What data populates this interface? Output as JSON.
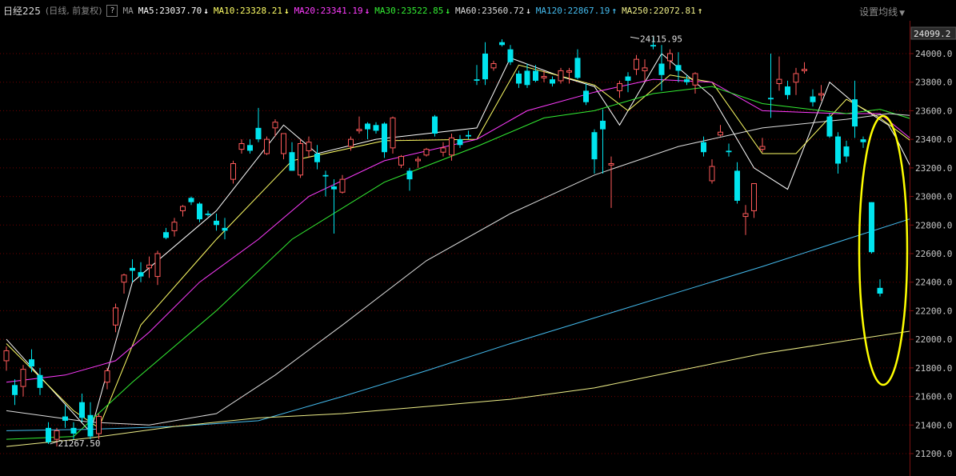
{
  "header": {
    "title": "日经225",
    "subtitle": "(日线, 前复权)",
    "help_icon": "?",
    "ma_label": "MA",
    "settings_label": "设置均线"
  },
  "ma_items": [
    {
      "label": "MA5:23037.70",
      "color": "#ffffff",
      "arrow": "↓",
      "arrow_color": "#ffffff"
    },
    {
      "label": "MA10:23328.21",
      "color": "#ffff66",
      "arrow": "↓",
      "arrow_color": "#ffff66"
    },
    {
      "label": "MA20:23341.19",
      "color": "#ff3cff",
      "arrow": "↓",
      "arrow_color": "#ff3cff"
    },
    {
      "label": "MA30:23522.85",
      "color": "#33ee33",
      "arrow": "↓",
      "arrow_color": "#33ee33"
    },
    {
      "label": "MA60:23560.72",
      "color": "#dddddd",
      "arrow": "↓",
      "arrow_color": "#dddddd"
    },
    {
      "label": "MA120:22867.19",
      "color": "#44bbee",
      "arrow": "↑",
      "arrow_color": "#44bbee"
    },
    {
      "label": "MA250:22072.81",
      "color": "#eeee88",
      "arrow": "↑",
      "arrow_color": "#eeee88"
    }
  ],
  "colors": {
    "up": "#ff5a5a",
    "down": "#00e4ee",
    "grid": "#700000",
    "axis_text": "#c8c8c8",
    "annotation": "#ffff00"
  },
  "chart_data": {
    "type": "candlestick",
    "ylim": [
      21100,
      24200
    ],
    "y_ticks": [
      24000,
      23800,
      23600,
      23400,
      23200,
      23000,
      22800,
      22600,
      22400,
      22200,
      22000,
      21800,
      21600,
      21400,
      21200
    ],
    "y_tick_labels": [
      "24000.0",
      "23800.0",
      "23600.0",
      "23400.0",
      "23200.0",
      "23000.0",
      "22800.0",
      "22600.0",
      "22400.0",
      "22200.0",
      "22000.0",
      "21800.0",
      "21600.0",
      "21400.0",
      "21200.0"
    ],
    "last_price_label": "24099.2",
    "high_marker": {
      "label": "24115.95",
      "index": 74
    },
    "low_marker": {
      "label": "21267.50",
      "index": 5
    },
    "candles": [
      [
        21850,
        21950,
        21780,
        21920
      ],
      [
        21680,
        21720,
        21540,
        21610
      ],
      [
        21670,
        21820,
        21600,
        21790
      ],
      [
        21860,
        21930,
        21770,
        21810
      ],
      [
        21750,
        21800,
        21610,
        21660
      ],
      [
        21380,
        21420,
        21267.5,
        21280
      ],
      [
        21300,
        21380,
        21250,
        21360
      ],
      [
        21460,
        21540,
        21380,
        21430
      ],
      [
        21380,
        21420,
        21300,
        21340
      ],
      [
        21560,
        21620,
        21420,
        21450
      ],
      [
        21470,
        21560,
        21300,
        21320
      ],
      [
        21340,
        21480,
        21300,
        21460
      ],
      [
        21700,
        21800,
        21650,
        21780
      ],
      [
        22100,
        22250,
        22050,
        22220
      ],
      [
        22400,
        22460,
        22320,
        22450
      ],
      [
        22500,
        22560,
        22400,
        22480
      ],
      [
        22470,
        22540,
        22400,
        22440
      ],
      [
        22500,
        22580,
        22430,
        22520
      ],
      [
        22440,
        22620,
        22380,
        22600
      ],
      [
        22750,
        22780,
        22700,
        22710
      ],
      [
        22760,
        22850,
        22720,
        22820
      ],
      [
        22900,
        22940,
        22860,
        22930
      ],
      [
        22990,
        23000,
        22940,
        22960
      ],
      [
        22950,
        22960,
        22820,
        22840
      ],
      [
        22880,
        22900,
        22860,
        22870
      ],
      [
        22830,
        22880,
        22760,
        22800
      ],
      [
        22780,
        22850,
        22700,
        22760
      ],
      [
        23120,
        23250,
        23090,
        23230
      ],
      [
        23330,
        23400,
        23300,
        23370
      ],
      [
        23360,
        23400,
        23300,
        23320
      ],
      [
        23480,
        23620,
        23380,
        23400
      ],
      [
        23300,
        23420,
        23290,
        23400
      ],
      [
        23480,
        23540,
        23420,
        23520
      ],
      [
        23300,
        23440,
        23260,
        23440
      ],
      [
        23310,
        23380,
        23180,
        23180
      ],
      [
        23150,
        23400,
        23130,
        23370
      ],
      [
        23320,
        23420,
        23270,
        23380
      ],
      [
        23300,
        23360,
        23190,
        23240
      ],
      [
        23150,
        23180,
        23000,
        23140
      ],
      [
        23070,
        23120,
        22740,
        23050
      ],
      [
        23030,
        23150,
        23020,
        23120
      ],
      [
        23350,
        23420,
        23320,
        23400
      ],
      [
        23460,
        23560,
        23440,
        23470
      ],
      [
        23510,
        23520,
        23400,
        23470
      ],
      [
        23500,
        23520,
        23440,
        23460
      ],
      [
        23510,
        23520,
        23270,
        23310
      ],
      [
        23340,
        23560,
        23300,
        23550
      ],
      [
        23220,
        23290,
        23200,
        23280
      ],
      [
        23180,
        23200,
        23040,
        23120
      ],
      [
        23250,
        23280,
        23200,
        23260
      ],
      [
        23290,
        23340,
        23280,
        23330
      ],
      [
        23560,
        23570,
        23420,
        23440
      ],
      [
        23310,
        23380,
        23280,
        23340
      ],
      [
        23290,
        23440,
        23250,
        23410
      ],
      [
        23400,
        23430,
        23340,
        23360
      ],
      [
        23430,
        23460,
        23400,
        23420
      ],
      [
        23820,
        23920,
        23780,
        23810
      ],
      [
        24000,
        24080,
        23780,
        23820
      ],
      [
        23900,
        23950,
        23880,
        23930
      ],
      [
        24080,
        24100,
        24050,
        24060
      ],
      [
        24030,
        24060,
        23920,
        23940
      ],
      [
        23860,
        23880,
        23760,
        23790
      ],
      [
        23880,
        23930,
        23760,
        23780
      ],
      [
        23880,
        23920,
        23800,
        23810
      ],
      [
        23830,
        23880,
        23800,
        23840
      ],
      [
        23820,
        23840,
        23770,
        23790
      ],
      [
        23810,
        23900,
        23790,
        23880
      ],
      [
        23870,
        23900,
        23790,
        23880
      ],
      [
        23970,
        24030,
        23820,
        23830
      ],
      [
        23740,
        23790,
        23640,
        23660
      ],
      [
        23450,
        23470,
        23160,
        23260
      ],
      [
        23530,
        23610,
        23160,
        23470
      ],
      [
        23220,
        23280,
        22920,
        23230
      ],
      [
        23740,
        23810,
        23690,
        23790
      ],
      [
        23840,
        23870,
        23730,
        23810
      ],
      [
        23890,
        23990,
        23850,
        23960
      ],
      [
        23880,
        23960,
        23810,
        23900
      ],
      [
        24060,
        24115.95,
        24030,
        24050
      ],
      [
        23930,
        24060,
        23740,
        23850
      ],
      [
        23950,
        24030,
        23890,
        24000
      ],
      [
        23920,
        24010,
        23800,
        23880
      ],
      [
        23820,
        23850,
        23780,
        23800
      ],
      [
        23780,
        23870,
        23720,
        23860
      ],
      [
        23380,
        23420,
        23280,
        23310
      ],
      [
        23110,
        23260,
        23090,
        23210
      ],
      [
        23430,
        23500,
        23420,
        23450
      ],
      [
        23320,
        23370,
        23280,
        23310
      ],
      [
        23180,
        23240,
        22950,
        22970
      ],
      [
        22860,
        22940,
        22730,
        22880
      ],
      [
        22900,
        23080,
        22850,
        23090
      ],
      [
        23330,
        23410,
        23310,
        23350
      ],
      [
        23690,
        24000,
        23550,
        23680
      ],
      [
        23790,
        23980,
        23740,
        23820
      ],
      [
        23770,
        23810,
        23680,
        23710
      ],
      [
        23800,
        23900,
        23710,
        23860
      ],
      [
        23880,
        23940,
        23860,
        23890
      ],
      [
        23700,
        23750,
        23630,
        23660
      ],
      [
        23710,
        23780,
        23670,
        23720
      ],
      [
        23560,
        23580,
        23410,
        23420
      ],
      [
        23420,
        23450,
        23160,
        23230
      ],
      [
        23350,
        23390,
        23240,
        23280
      ],
      [
        23680,
        23810,
        23410,
        23490
      ],
      [
        23400,
        23420,
        23340,
        23380
      ],
      [
        22960,
        22960,
        22600,
        22610
      ],
      [
        22360,
        22420,
        22300,
        22320
      ]
    ],
    "ma_series": [
      {
        "name": "MA5",
        "color": "#ffffff",
        "values": [
          [
            0,
            22000
          ],
          [
            10,
            21350
          ],
          [
            15,
            22400
          ],
          [
            25,
            22900
          ],
          [
            33,
            23500
          ],
          [
            37,
            23300
          ],
          [
            44,
            23400
          ],
          [
            56,
            23480
          ],
          [
            60,
            23970
          ],
          [
            66,
            23840
          ],
          [
            70,
            23770
          ],
          [
            73,
            23500
          ],
          [
            78,
            24000
          ],
          [
            84,
            23700
          ],
          [
            89,
            23200
          ],
          [
            93,
            23050
          ],
          [
            98,
            23800
          ],
          [
            101,
            23650
          ],
          [
            105,
            23500
          ],
          [
            106,
            23400
          ],
          [
            109,
            23050
          ]
        ]
      },
      {
        "name": "MA10",
        "color": "#ffff66",
        "values": [
          [
            0,
            21970
          ],
          [
            8,
            21500
          ],
          [
            11,
            21380
          ],
          [
            16,
            22100
          ],
          [
            25,
            22700
          ],
          [
            34,
            23250
          ],
          [
            45,
            23390
          ],
          [
            56,
            23400
          ],
          [
            61,
            23920
          ],
          [
            70,
            23780
          ],
          [
            74,
            23600
          ],
          [
            79,
            23850
          ],
          [
            84,
            23800
          ],
          [
            90,
            23300
          ],
          [
            94,
            23300
          ],
          [
            100,
            23680
          ],
          [
            104,
            23550
          ],
          [
            109,
            23330
          ]
        ]
      },
      {
        "name": "MA20",
        "color": "#ff3cff",
        "values": [
          [
            0,
            21700
          ],
          [
            7,
            21750
          ],
          [
            13,
            21850
          ],
          [
            17,
            22050
          ],
          [
            23,
            22400
          ],
          [
            30,
            22700
          ],
          [
            36,
            23000
          ],
          [
            45,
            23250
          ],
          [
            56,
            23400
          ],
          [
            62,
            23600
          ],
          [
            70,
            23730
          ],
          [
            77,
            23820
          ],
          [
            84,
            23800
          ],
          [
            90,
            23600
          ],
          [
            99,
            23580
          ],
          [
            104,
            23580
          ],
          [
            109,
            23340
          ]
        ]
      },
      {
        "name": "MA30",
        "color": "#33ee33",
        "values": [
          [
            0,
            21300
          ],
          [
            8,
            21320
          ],
          [
            15,
            21700
          ],
          [
            25,
            22200
          ],
          [
            34,
            22700
          ],
          [
            45,
            23100
          ],
          [
            56,
            23350
          ],
          [
            64,
            23550
          ],
          [
            70,
            23600
          ],
          [
            77,
            23720
          ],
          [
            84,
            23770
          ],
          [
            90,
            23650
          ],
          [
            100,
            23580
          ],
          [
            104,
            23610
          ],
          [
            109,
            23520
          ]
        ]
      },
      {
        "name": "MA60",
        "color": "#dddddd",
        "values": [
          [
            0,
            21500
          ],
          [
            10,
            21420
          ],
          [
            17,
            21400
          ],
          [
            25,
            21480
          ],
          [
            32,
            21750
          ],
          [
            40,
            22100
          ],
          [
            50,
            22550
          ],
          [
            60,
            22880
          ],
          [
            70,
            23150
          ],
          [
            80,
            23350
          ],
          [
            90,
            23480
          ],
          [
            100,
            23540
          ],
          [
            105,
            23580
          ],
          [
            109,
            23560
          ]
        ]
      },
      {
        "name": "MA120",
        "color": "#44bbee",
        "values": [
          [
            0,
            21360
          ],
          [
            10,
            21370
          ],
          [
            20,
            21390
          ],
          [
            30,
            21430
          ],
          [
            40,
            21600
          ],
          [
            50,
            21780
          ],
          [
            60,
            21970
          ],
          [
            70,
            22150
          ],
          [
            80,
            22330
          ],
          [
            90,
            22510
          ],
          [
            100,
            22700
          ],
          [
            109,
            22870
          ]
        ]
      },
      {
        "name": "MA250",
        "color": "#eeee88",
        "values": [
          [
            0,
            21250
          ],
          [
            10,
            21310
          ],
          [
            20,
            21390
          ],
          [
            30,
            21450
          ],
          [
            40,
            21480
          ],
          [
            50,
            21530
          ],
          [
            60,
            21580
          ],
          [
            70,
            21660
          ],
          [
            80,
            21780
          ],
          [
            90,
            21900
          ],
          [
            100,
            21990
          ],
          [
            109,
            22070
          ]
        ]
      }
    ]
  }
}
